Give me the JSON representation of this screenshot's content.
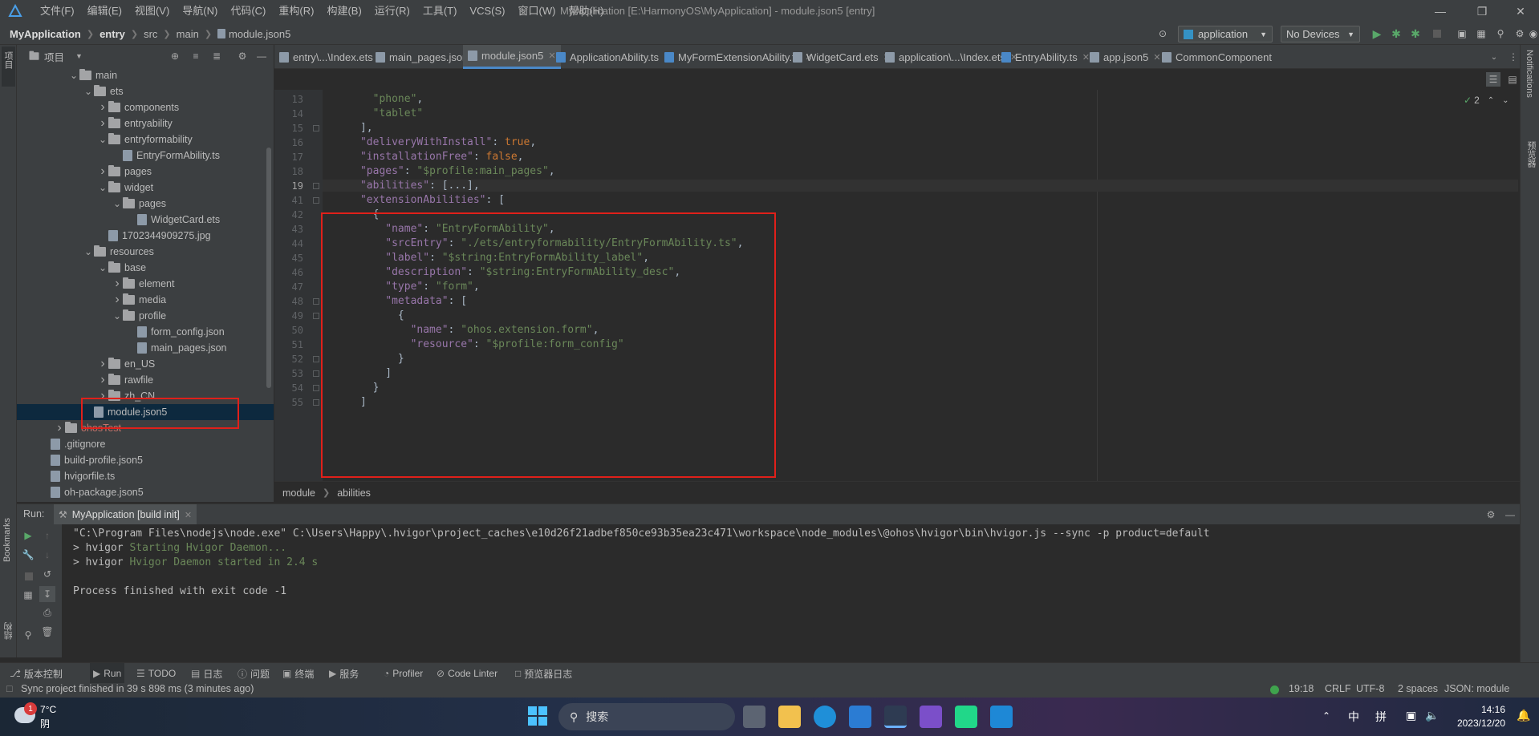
{
  "menubar": {
    "items": [
      "文件(F)",
      "编辑(E)",
      "视图(V)",
      "导航(N)",
      "代码(C)",
      "重构(R)",
      "构建(B)",
      "运行(R)",
      "工具(T)",
      "VCS(S)",
      "窗口(W)",
      "帮助(H)"
    ],
    "title": "MyApplication [E:\\HarmonyOS\\MyApplication] - module.json5 [entry]"
  },
  "navbar": {
    "crumbs": [
      "MyApplication",
      "entry",
      "src",
      "main",
      "module.json5"
    ],
    "run_config": "application",
    "devices": "No Devices"
  },
  "project": {
    "header": "项目",
    "tree": [
      {
        "label": "main",
        "depth": 0,
        "type": "folder",
        "arrow": "open"
      },
      {
        "label": "ets",
        "depth": 1,
        "type": "folder",
        "arrow": "open"
      },
      {
        "label": "components",
        "depth": 2,
        "type": "folder",
        "arrow": "closed"
      },
      {
        "label": "entryability",
        "depth": 2,
        "type": "folder",
        "arrow": "closed"
      },
      {
        "label": "entryformability",
        "depth": 2,
        "type": "folder",
        "arrow": "open"
      },
      {
        "label": "EntryFormAbility.ts",
        "depth": 3,
        "type": "file",
        "arrow": ""
      },
      {
        "label": "pages",
        "depth": 2,
        "type": "folder",
        "arrow": "closed"
      },
      {
        "label": "widget",
        "depth": 2,
        "type": "folder",
        "arrow": "open"
      },
      {
        "label": "pages",
        "depth": 3,
        "type": "folder",
        "arrow": "open"
      },
      {
        "label": "WidgetCard.ets",
        "depth": 4,
        "type": "file",
        "arrow": ""
      },
      {
        "label": "1702344909275.jpg",
        "depth": 2,
        "type": "file",
        "arrow": ""
      },
      {
        "label": "resources",
        "depth": 1,
        "type": "folder",
        "arrow": "open"
      },
      {
        "label": "base",
        "depth": 2,
        "type": "folder",
        "arrow": "open"
      },
      {
        "label": "element",
        "depth": 3,
        "type": "folder",
        "arrow": "closed"
      },
      {
        "label": "media",
        "depth": 3,
        "type": "folder",
        "arrow": "closed"
      },
      {
        "label": "profile",
        "depth": 3,
        "type": "folder",
        "arrow": "open"
      },
      {
        "label": "form_config.json",
        "depth": 4,
        "type": "file",
        "arrow": ""
      },
      {
        "label": "main_pages.json",
        "depth": 4,
        "type": "file",
        "arrow": ""
      },
      {
        "label": "en_US",
        "depth": 2,
        "type": "folder",
        "arrow": "closed"
      },
      {
        "label": "rawfile",
        "depth": 2,
        "type": "folder",
        "arrow": "closed"
      },
      {
        "label": "zh_CN",
        "depth": 2,
        "type": "folder",
        "arrow": "closed"
      },
      {
        "label": "module.json5",
        "depth": 1,
        "type": "file",
        "arrow": "",
        "selected": true
      },
      {
        "label": "ohosTest",
        "depth": -1,
        "type": "folder",
        "arrow": "closed"
      },
      {
        "label": ".gitignore",
        "depth": -2,
        "type": "file",
        "arrow": ""
      },
      {
        "label": "build-profile.json5",
        "depth": -2,
        "type": "file",
        "arrow": ""
      },
      {
        "label": "hvigorfile.ts",
        "depth": -2,
        "type": "file",
        "arrow": ""
      },
      {
        "label": "oh-package.json5",
        "depth": -2,
        "type": "file",
        "arrow": ""
      }
    ]
  },
  "tabs": [
    {
      "label": "entry\\...\\Index.ets",
      "color": "#8d9aa8"
    },
    {
      "label": "main_pages.json",
      "color": "#8d9aa8"
    },
    {
      "label": "module.json5",
      "color": "#8d9aa8",
      "active": true
    },
    {
      "label": "ApplicationAbility.ts",
      "color": "#4a88c7"
    },
    {
      "label": "MyFormExtensionAbility.ts",
      "color": "#4a88c7"
    },
    {
      "label": "WidgetCard.ets",
      "color": "#8d9aa8"
    },
    {
      "label": "application\\...\\Index.ets",
      "color": "#8d9aa8"
    },
    {
      "label": "EntryAbility.ts",
      "color": "#4a88c7"
    },
    {
      "label": "app.json5",
      "color": "#8d9aa8"
    },
    {
      "label": "CommonComponent",
      "color": "#8d9aa8"
    }
  ],
  "editor": {
    "inspection_count": "2",
    "lines": [
      {
        "n": "13",
        "code": [
          [
            "        ",
            ""
          ],
          [
            "\"phone\"",
            "s"
          ],
          [
            ",",
            ""
          ]
        ]
      },
      {
        "n": "14",
        "code": [
          [
            "        ",
            ""
          ],
          [
            "\"tablet\"",
            "s"
          ]
        ]
      },
      {
        "n": "15",
        "code": [
          [
            "      ],",
            ""
          ]
        ]
      },
      {
        "n": "16",
        "code": [
          [
            "      ",
            ""
          ],
          [
            "\"deliveryWithInstall\"",
            "k"
          ],
          [
            ": ",
            ""
          ],
          [
            "true",
            "kw"
          ],
          [
            ",",
            ""
          ]
        ]
      },
      {
        "n": "17",
        "code": [
          [
            "      ",
            ""
          ],
          [
            "\"installationFree\"",
            "k"
          ],
          [
            ": ",
            ""
          ],
          [
            "false",
            "kw"
          ],
          [
            ",",
            ""
          ]
        ]
      },
      {
        "n": "18",
        "code": [
          [
            "      ",
            ""
          ],
          [
            "\"pages\"",
            "k"
          ],
          [
            ": ",
            ""
          ],
          [
            "\"$profile:main_pages\"",
            "s"
          ],
          [
            ",",
            ""
          ]
        ]
      },
      {
        "n": "19",
        "code": [
          [
            "      ",
            ""
          ],
          [
            "\"abilities\"",
            "k"
          ],
          [
            ": [...],",
            ""
          ]
        ]
      },
      {
        "n": "41",
        "code": [
          [
            "      ",
            ""
          ],
          [
            "\"extensionAbilities\"",
            "k"
          ],
          [
            ": [",
            ""
          ]
        ]
      },
      {
        "n": "42",
        "code": [
          [
            "        {",
            ""
          ]
        ]
      },
      {
        "n": "43",
        "code": [
          [
            "          ",
            ""
          ],
          [
            "\"name\"",
            "k"
          ],
          [
            ": ",
            ""
          ],
          [
            "\"EntryFormAbility\"",
            "s"
          ],
          [
            ",",
            ""
          ]
        ]
      },
      {
        "n": "44",
        "code": [
          [
            "          ",
            ""
          ],
          [
            "\"srcEntry\"",
            "k"
          ],
          [
            ": ",
            ""
          ],
          [
            "\"./ets/entryformability/EntryFormAbility.ts\"",
            "s"
          ],
          [
            ",",
            ""
          ]
        ]
      },
      {
        "n": "45",
        "code": [
          [
            "          ",
            ""
          ],
          [
            "\"label\"",
            "k"
          ],
          [
            ": ",
            ""
          ],
          [
            "\"$string:EntryFormAbility_label\"",
            "s"
          ],
          [
            ",",
            ""
          ]
        ]
      },
      {
        "n": "46",
        "code": [
          [
            "          ",
            ""
          ],
          [
            "\"description\"",
            "k"
          ],
          [
            ": ",
            ""
          ],
          [
            "\"$string:EntryFormAbility_desc\"",
            "s"
          ],
          [
            ",",
            ""
          ]
        ]
      },
      {
        "n": "47",
        "code": [
          [
            "          ",
            ""
          ],
          [
            "\"type\"",
            "k"
          ],
          [
            ": ",
            ""
          ],
          [
            "\"form\"",
            "s"
          ],
          [
            ",",
            ""
          ]
        ]
      },
      {
        "n": "48",
        "code": [
          [
            "          ",
            ""
          ],
          [
            "\"metadata\"",
            "k"
          ],
          [
            ": [",
            ""
          ]
        ]
      },
      {
        "n": "49",
        "code": [
          [
            "            {",
            ""
          ]
        ]
      },
      {
        "n": "50",
        "code": [
          [
            "              ",
            ""
          ],
          [
            "\"name\"",
            "k"
          ],
          [
            ": ",
            ""
          ],
          [
            "\"ohos.extension.form\"",
            "s"
          ],
          [
            ",",
            ""
          ]
        ]
      },
      {
        "n": "51",
        "code": [
          [
            "              ",
            ""
          ],
          [
            "\"resource\"",
            "k"
          ],
          [
            ": ",
            ""
          ],
          [
            "\"$profile:form_config\"",
            "s"
          ]
        ]
      },
      {
        "n": "52",
        "code": [
          [
            "            }",
            ""
          ]
        ]
      },
      {
        "n": "53",
        "code": [
          [
            "          ]",
            ""
          ]
        ]
      },
      {
        "n": "54",
        "code": [
          [
            "        }",
            ""
          ]
        ]
      },
      {
        "n": "55",
        "code": [
          [
            "      ]",
            ""
          ]
        ]
      }
    ],
    "breadcrumb": [
      "module",
      "abilities"
    ]
  },
  "run": {
    "label": "Run:",
    "tab": "MyApplication [build init]",
    "console": [
      {
        "parts": [
          [
            "\"C:\\Program Files\\nodejs\\node.exe\" C:\\Users\\Happy\\.hvigor\\project_caches\\e10d26f21adbef850ce93b35ea23c471\\workspace\\node_modules\\@ohos\\hvigor\\bin\\hvigor.js --sync -p product=default",
            ""
          ]
        ]
      },
      {
        "parts": [
          [
            "> hvigor ",
            ""
          ],
          [
            "Starting Hvigor Daemon...",
            "cg"
          ]
        ]
      },
      {
        "parts": [
          [
            "> hvigor ",
            ""
          ],
          [
            "Hvigor Daemon started in 2.4 s",
            "cg"
          ]
        ]
      },
      {
        "parts": [
          [
            "",
            ""
          ]
        ]
      },
      {
        "parts": [
          [
            "Process finished with exit code -1",
            ""
          ]
        ]
      }
    ]
  },
  "toolwindows": [
    "版本控制",
    "Run",
    "TODO",
    "日志",
    "问题",
    "终端",
    "服务",
    "Profiler",
    "Code Linter",
    "预览器日志"
  ],
  "status": {
    "message": "Sync project finished in 39 s 898 ms (3 minutes ago)",
    "position": "19:18",
    "line_sep": "CRLF",
    "encoding": "UTF-8",
    "indent": "2 spaces",
    "schema": "JSON: module"
  },
  "side": {
    "left_project": "项目",
    "bookmarks": "Bookmarks",
    "structure": "结构",
    "notifications": "Notifications",
    "preview": "预览器"
  },
  "taskbar": {
    "weather_temp": "7°C",
    "weather_desc": "阴",
    "badge": "1",
    "search": "搜索",
    "ime_lang": "中",
    "ime_mode": "拼",
    "time": "14:16",
    "date": "2023/12/20"
  }
}
